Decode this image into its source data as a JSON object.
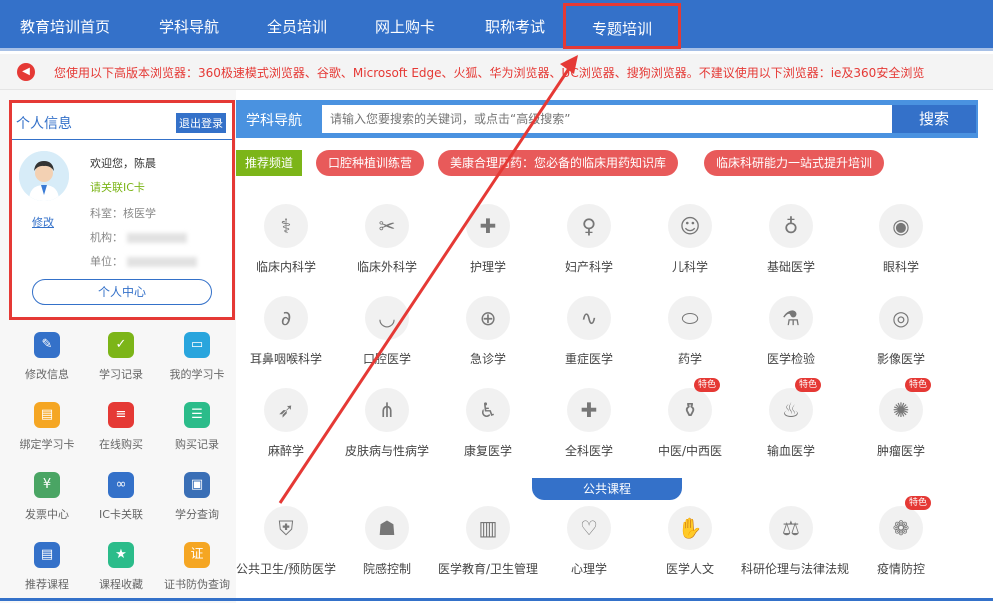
{
  "nav": [
    "教育培训首页",
    "学科导航",
    "全员培训",
    "网上购卡",
    "职称考试",
    "专题培训"
  ],
  "notice": "您使用以下高版本浏览器：360极速模式浏览器、谷歌、Microsoft Edge、火狐、华为浏览器、UC浏览器、搜狗浏览器。不建议使用以下浏览器：ie及360安全浏览",
  "profile": {
    "title": "个人信息",
    "logout": "退出登录",
    "welcome": "欢迎您，陈晨",
    "ic_link": "请关联IC卡",
    "dept": "科室：核医学",
    "org_label": "机构：",
    "unit_label": "单位：",
    "modify": "修改",
    "center": "个人中心"
  },
  "quick": [
    {
      "label": "修改信息",
      "icon": "edit-icon",
      "color": "#3471c9",
      "glyph": "✎"
    },
    {
      "label": "学习记录",
      "icon": "bookmark-icon",
      "color": "#7cb518",
      "glyph": "✓"
    },
    {
      "label": "我的学习卡",
      "icon": "card-icon",
      "color": "#29a5dd",
      "glyph": "▭"
    },
    {
      "label": "绑定学习卡",
      "icon": "card-bind-icon",
      "color": "#f5a623",
      "glyph": "▤"
    },
    {
      "label": "在线购买",
      "icon": "cart-icon",
      "color": "#e53935",
      "glyph": "≡"
    },
    {
      "label": "购买记录",
      "icon": "receipt-icon",
      "color": "#2bbc8a",
      "glyph": "☰"
    },
    {
      "label": "发票中心",
      "icon": "invoice-icon",
      "color": "#4aa564",
      "glyph": "¥"
    },
    {
      "label": "IC卡关联",
      "icon": "link-icon",
      "color": "#3471c9",
      "glyph": "∞"
    },
    {
      "label": "学分查询",
      "icon": "monitor-icon",
      "color": "#3a6fb6",
      "glyph": "▣"
    },
    {
      "label": "推荐课程",
      "icon": "course-icon",
      "color": "#3471c9",
      "glyph": "▤"
    },
    {
      "label": "课程收藏",
      "icon": "star-icon",
      "color": "#2bbc8a",
      "glyph": "★"
    },
    {
      "label": "证书防伪查询",
      "icon": "certificate-icon",
      "color": "#f5a623",
      "glyph": "证"
    }
  ],
  "search": {
    "label": "学科导航",
    "placeholder": "请输入您要搜索的关键词，或点击“高级搜索”",
    "button": "搜索",
    "advanced": "高级搜索"
  },
  "recommend": {
    "tag": "推荐频道",
    "items": [
      "口腔种植训练营",
      "美康合理用药：您必备的临床用药知识库",
      "临床科研能力一站式提升培训"
    ]
  },
  "subjects": [
    [
      {
        "name": "临床内科学",
        "icon": "lungs-icon",
        "glyph": "⚕"
      },
      {
        "name": "临床外科学",
        "icon": "scalpel-icon",
        "glyph": "✂"
      },
      {
        "name": "护理学",
        "icon": "nursing-cross-icon",
        "glyph": "✚"
      },
      {
        "name": "妇产科学",
        "icon": "fetus-icon",
        "glyph": "♀"
      },
      {
        "name": "儿科学",
        "icon": "child-face-icon",
        "glyph": "☺"
      },
      {
        "name": "基础医学",
        "icon": "stethoscope-icon",
        "glyph": "♁"
      },
      {
        "name": "眼科学",
        "icon": "eye-icon",
        "glyph": "◉"
      }
    ],
    [
      {
        "name": "耳鼻咽喉科学",
        "icon": "ear-icon",
        "glyph": "∂"
      },
      {
        "name": "口腔医学",
        "icon": "mouth-icon",
        "glyph": "◡"
      },
      {
        "name": "急诊学",
        "icon": "emergency-icon",
        "glyph": "⊕"
      },
      {
        "name": "重症医学",
        "icon": "ecg-icon",
        "glyph": "∿"
      },
      {
        "name": "药学",
        "icon": "pill-icon",
        "glyph": "⬭"
      },
      {
        "name": "医学检验",
        "icon": "flask-icon",
        "glyph": "⚗"
      },
      {
        "name": "影像医学",
        "icon": "scanner-icon",
        "glyph": "◎"
      }
    ],
    [
      {
        "name": "麻醉学",
        "icon": "syringe-icon",
        "glyph": "➶",
        "badge": ""
      },
      {
        "name": "皮肤病与性病学",
        "icon": "skin-icon",
        "glyph": "⋔",
        "badge": ""
      },
      {
        "name": "康复医学",
        "icon": "walker-icon",
        "glyph": "♿",
        "badge": ""
      },
      {
        "name": "全科医学",
        "icon": "folder-cross-icon",
        "glyph": "✚",
        "badge": ""
      },
      {
        "name": "中医/中西医",
        "icon": "mortar-icon",
        "glyph": "⚱",
        "badge": "特色"
      },
      {
        "name": "输血医学",
        "icon": "blood-drip-icon",
        "glyph": "♨",
        "badge": "特色"
      },
      {
        "name": "肿瘤医学",
        "icon": "tumor-icon",
        "glyph": "✺",
        "badge": "特色"
      }
    ],
    [
      {
        "name": "公共卫生/预防医学",
        "icon": "shield-icon",
        "glyph": "⛨",
        "badge": ""
      },
      {
        "name": "院感控制",
        "icon": "mask-icon",
        "glyph": "☗",
        "badge": ""
      },
      {
        "name": "医学教育/卫生管理",
        "icon": "book-icon",
        "glyph": "▥",
        "badge": ""
      },
      {
        "name": "心理学",
        "icon": "heart-hand-icon",
        "glyph": "♡",
        "badge": ""
      },
      {
        "name": "医学人文",
        "icon": "handshake-icon",
        "glyph": "✋",
        "badge": ""
      },
      {
        "name": "科研伦理与法律法规",
        "icon": "scales-icon",
        "glyph": "⚖",
        "badge": ""
      },
      {
        "name": "疫情防控",
        "icon": "lungs-virus-icon",
        "glyph": "❁",
        "badge": "特色"
      }
    ]
  ],
  "public_label": "公共课程",
  "colors": {
    "primary": "#3471c9",
    "highlight": "#e53935",
    "green": "#7cb518"
  }
}
